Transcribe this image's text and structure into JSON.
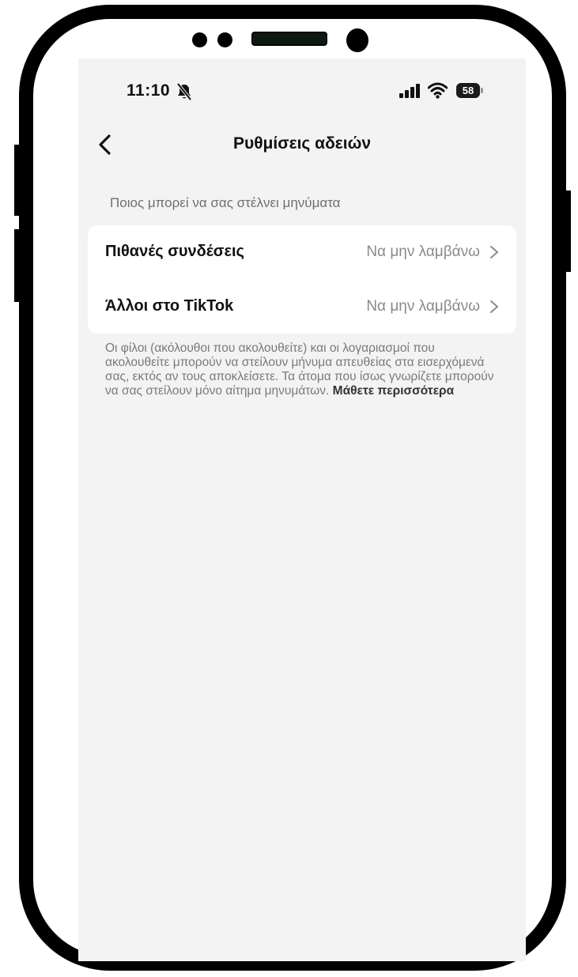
{
  "status_bar": {
    "time": "11:10",
    "battery_level": "58",
    "icons": [
      "bell-off-icon",
      "signal-icon",
      "wifi-icon",
      "battery-icon"
    ]
  },
  "nav": {
    "title": "Ρυθμίσεις αδειών",
    "back_icon": "chevron-left-icon"
  },
  "section": {
    "header": "Ποιος μπορεί να σας στέλνει μηνύματα",
    "rows": [
      {
        "label": "Πιθανές συνδέσεις",
        "value": "Να μην λαμβάνω"
      },
      {
        "label": "Άλλοι στο TikTok",
        "value": "Να μην λαμβάνω"
      }
    ]
  },
  "footnote": {
    "text": "Οι φίλοι (ακόλουθοι που ακολουθείτε) και οι λογαριασμοί που ακολουθείτε μπορούν να στείλουν μήνυμα απευθείας στα εισερχόμενά σας, εκτός αν τους αποκλείσετε. Τα άτομα που ίσως γνωρίζετε μπορούν να σας στείλουν μόνο αίτημα μηνυμάτων.",
    "link": "Μάθετε περισσότερα"
  },
  "colors": {
    "screen_bg": "#f3f3f3",
    "card_bg": "#ffffff",
    "primary_text": "#111111",
    "secondary_text": "#8a8a8a"
  }
}
